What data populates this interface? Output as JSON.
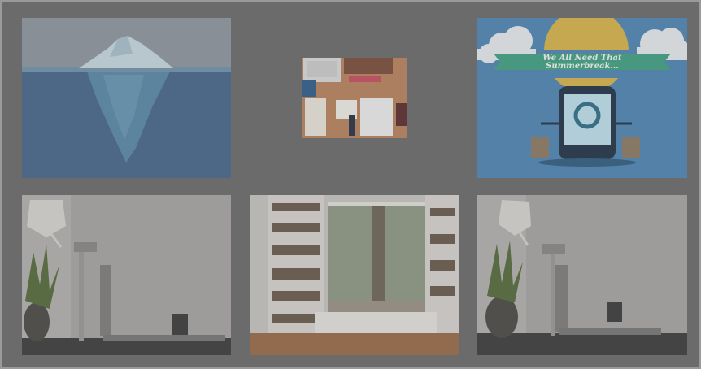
{
  "gallery": {
    "images": [
      {
        "id": "iceberg",
        "icon": "iceberg-illustration"
      },
      {
        "id": "desk-flatlay",
        "icon": "desk-flatlay-photo"
      },
      {
        "id": "summer-poster",
        "icon": "summer-break-poster",
        "banner_line1": "We All Need That",
        "banner_line2": "Summerbreak..."
      },
      {
        "id": "office-left",
        "icon": "office-desk-photo"
      },
      {
        "id": "reading-nook",
        "icon": "reading-nook-photo"
      },
      {
        "id": "office-right",
        "icon": "office-desk-photo"
      }
    ]
  },
  "colors": {
    "background": "#6b6b6b",
    "frame_border": "#9a9a9a",
    "sky": "#8f98a0",
    "sea": "#4a6a8e",
    "poster_blue": "#4d86b4",
    "poster_sun": "#d8b548",
    "poster_ribbon": "#3fa283"
  }
}
